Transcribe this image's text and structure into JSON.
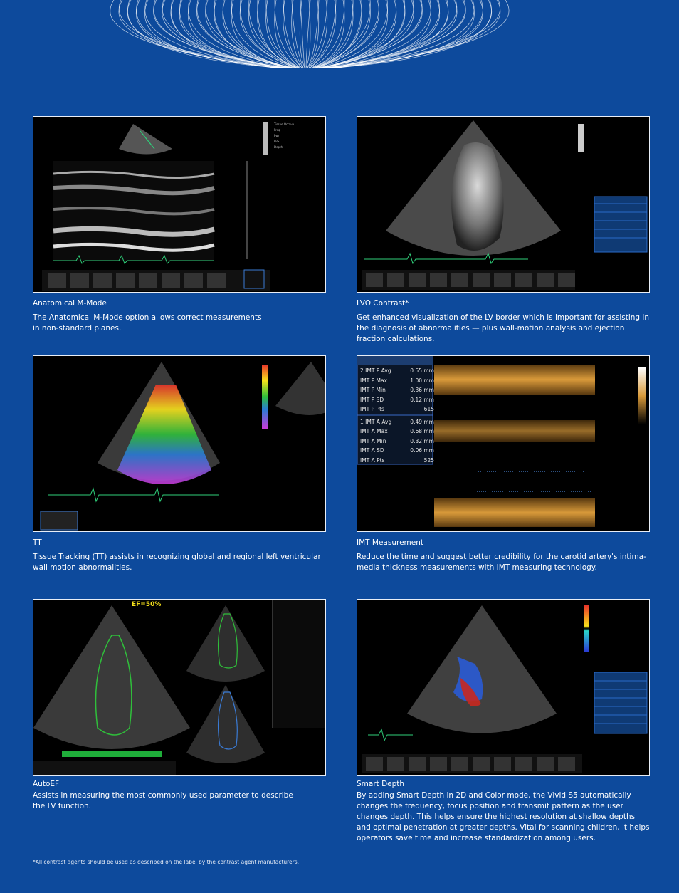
{
  "panels": [
    {
      "title": "Anatomical M-Mode",
      "description": "The Anatomical M-Mode option allows correct measurements\nin non-standard planes."
    },
    {
      "title": "LVO Contrast*",
      "description": "Get enhanced visualization of the LV border which is important for assisting in the diagnosis of abnormalities — plus wall-motion analysis and ejection fraction calculations."
    },
    {
      "title": "TT",
      "description": "Tissue Tracking (TT) assists in recognizing global and regional left ventricular wall motion abnormalities."
    },
    {
      "title": "IMT Measurement",
      "description": "Reduce the time and suggest better credibility for the carotid artery's intima-media thickness measurements with IMT measuring technology."
    },
    {
      "title": "AutoEF",
      "description": "Assists in measuring the most commonly used parameter to describe\nthe LV function."
    },
    {
      "title": "Smart Depth",
      "description": "By adding Smart Depth in 2D and Color mode, the Vivid S5 automatically changes the frequency, focus position and transmit pattern as the user changes depth. This helps ensure the highest resolution at shallow depths and optimal penetration at greater depths. Vital for scanning children, it helps operators save time and increase standardization among users."
    }
  ],
  "ef_label": "EF=50%",
  "imt": [
    {
      "label": "2 IMT P Avg",
      "value": "0.55 mm"
    },
    {
      "label": "IMT P Max",
      "value": "1.00 mm"
    },
    {
      "label": "IMT P Min",
      "value": "0.36 mm"
    },
    {
      "label": "IMT P SD",
      "value": "0.12 mm"
    },
    {
      "label": "IMT P Pts",
      "value": "615"
    },
    {
      "label": "1 IMT A Avg",
      "value": "0.49 mm"
    },
    {
      "label": "IMT A Max",
      "value": "0.68 mm"
    },
    {
      "label": "IMT A Min",
      "value": "0.32 mm"
    },
    {
      "label": "IMT A SD",
      "value": "0.06 mm"
    },
    {
      "label": "IMT A Pts",
      "value": "525"
    }
  ],
  "footnote": "*All contrast agents should be used as described on the label by the contrast agent manufacturers.",
  "colors": {
    "background": "#0d4a9c",
    "ecg": "#2fd07a",
    "ef_bar": "#1fae3a"
  }
}
